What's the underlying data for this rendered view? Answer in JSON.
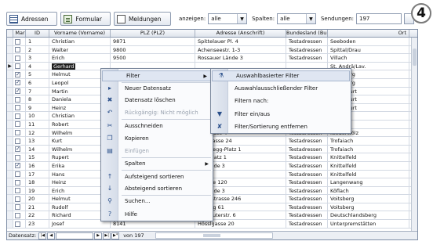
{
  "tabs": [
    {
      "label": "Adressen",
      "icon": "table-icon"
    },
    {
      "label": "Formular",
      "icon": "form-icon"
    },
    {
      "label": "Meldungen",
      "icon": "document-icon"
    }
  ],
  "toolbar": {
    "anzeigen_label": "anzeigen:",
    "anzeigen_value": "alle",
    "spalten_label": "Spalten:",
    "spalten_value": "alle",
    "sendungen_label": "Sendungen:",
    "sendungen_value": "197"
  },
  "badge": "4",
  "grid": {
    "columns": [
      "Mar",
      "ID",
      "Vorname (Vorname)",
      "PLZ (PLZ)",
      "Adresse (Anschrift)",
      "Bundesland (Bun",
      "Ort"
    ],
    "rows": [
      {
        "marked": false,
        "id": "1",
        "name": "Christian",
        "plz": "9871",
        "adresse": "Spittelauer Pl. 4",
        "bundesland": "Testadressen",
        "ort": "Seeboden"
      },
      {
        "marked": false,
        "id": "2",
        "name": "Walter",
        "plz": "9800",
        "adresse": "Achenseestr. 1-3",
        "bundesland": "Testadressen",
        "ort": "Spittal/Drau"
      },
      {
        "marked": false,
        "id": "3",
        "name": "Erich",
        "plz": "9500",
        "adresse": "Rossauer Lände 3",
        "bundesland": "Testadressen",
        "ort": "Villach"
      },
      {
        "marked": false,
        "id": "4",
        "name": "Gerhard",
        "plz": "",
        "adresse": "",
        "bundesland": "",
        "ort": "St. Andrä/Lav.",
        "current": true
      },
      {
        "marked": true,
        "id": "5",
        "name": "Helmut",
        "plz": "",
        "adresse": "",
        "bundesland": "",
        "ort": "Moosburg"
      },
      {
        "marked": true,
        "id": "6",
        "name": "Leopol",
        "plz": "",
        "adresse": "",
        "bundesland": "",
        "ort": "Moosburg"
      },
      {
        "marked": true,
        "id": "7",
        "name": "Martin",
        "plz": "",
        "adresse": "",
        "bundesland": "",
        "ort": "Klagenfurt"
      },
      {
        "marked": false,
        "id": "8",
        "name": "Daniela",
        "plz": "",
        "adresse": "",
        "bundesland": "",
        "ort": "Klagenfurt"
      },
      {
        "marked": false,
        "id": "9",
        "name": "Heinz",
        "plz": "",
        "adresse": "",
        "bundesland": "",
        "ort": "Klagenfurt"
      },
      {
        "marked": false,
        "id": "10",
        "name": "Christian",
        "plz": "",
        "adresse": "",
        "bundesland": "",
        "ort": "Gerding"
      },
      {
        "marked": false,
        "id": "11",
        "name": "Robert",
        "plz": "",
        "adresse": "",
        "bundesland": "",
        "ort": "Liezen"
      },
      {
        "marked": false,
        "id": "12",
        "name": "Wilhelm",
        "plz": "",
        "adresse": "bengasse 4",
        "bundesland": "Testadressen",
        "ort": "Niederwölz"
      },
      {
        "marked": false,
        "id": "13",
        "name": "Kurt",
        "plz": "",
        "adresse": "aulstrasse 24",
        "bundesland": "Testadressen",
        "ort": "Trofaiach"
      },
      {
        "marked": true,
        "id": "14",
        "name": "Wilhelm",
        "plz": "",
        "adresse": "x-Jauregg-Platz 1",
        "bundesland": "Testadressen",
        "ort": "Trofaiach"
      },
      {
        "marked": false,
        "id": "15",
        "name": "Rupert",
        "plz": "",
        "adresse": "enerplatz 1",
        "bundesland": "Testadressen",
        "ort": "Knittelfeld"
      },
      {
        "marked": true,
        "id": "16",
        "name": "Erika",
        "plz": "",
        "adresse": "er Lände 3",
        "bundesland": "Testadressen",
        "ort": "Knittelfeld"
      },
      {
        "marked": false,
        "id": "17",
        "name": "Hans",
        "plz": "",
        "adresse": "tz 13a",
        "bundesland": "Testadressen",
        "ort": "Knittelfeld"
      },
      {
        "marked": false,
        "id": "18",
        "name": "Heinz",
        "plz": "",
        "adresse": "enzeile 120",
        "bundesland": "Testadressen",
        "ort": "Langenwang"
      },
      {
        "marked": false,
        "id": "19",
        "name": "Erich",
        "plz": "",
        "adresse": "er Lände 3",
        "bundesland": "Testadressen",
        "ort": "Köflach"
      },
      {
        "marked": false,
        "id": "20",
        "name": "Helmut",
        "plz": "",
        "adresse": "urgerstrasse 246",
        "bundesland": "Testadressen",
        "ort": "Voitsberg"
      },
      {
        "marked": false,
        "id": "21",
        "name": "Rudolf",
        "plz": "",
        "adresse": "uhlweg 61",
        "bundesland": "Testadressen",
        "ort": "Voitsberg"
      },
      {
        "marked": false,
        "id": "22",
        "name": "Richard",
        "plz": "8530",
        "adresse": "Computerstr. 6",
        "bundesland": "Testadressen",
        "ort": "Deutschlandsberg"
      },
      {
        "marked": false,
        "id": "23",
        "name": "Josef",
        "plz": "8141",
        "adresse": "Hösslgasse 20",
        "bundesland": "Testadressen",
        "ort": "Unterpremstätten"
      }
    ]
  },
  "nav": {
    "label": "Datensatz:",
    "of_label": "von 197"
  },
  "context_menu": {
    "items": [
      {
        "label": "Filter",
        "icon": "filter-icon",
        "highlight": true,
        "submenu": true
      },
      {
        "label": "Neuer Datensatz",
        "icon": "new-record-icon"
      },
      {
        "label": "Datensatz löschen",
        "icon": "delete-icon"
      },
      {
        "label": "Rückgängig: Nicht möglich",
        "icon": "undo-icon",
        "disabled": true
      },
      {
        "label": "Ausschneiden",
        "icon": "cut-icon"
      },
      {
        "label": "Kopieren",
        "icon": "copy-icon"
      },
      {
        "label": "Einfügen",
        "icon": "paste-icon",
        "disabled": true
      },
      {
        "label": "Spalten",
        "icon": "",
        "submenu": true
      },
      {
        "label": "Aufsteigend sortieren",
        "icon": "sort-asc-icon"
      },
      {
        "label": "Absteigend sortieren",
        "icon": "sort-desc-icon"
      },
      {
        "label": "Suchen...",
        "icon": "search-icon"
      },
      {
        "label": "Hilfe",
        "icon": "help-icon"
      }
    ]
  },
  "filter_submenu": {
    "items": [
      {
        "label": "Auswahlbasierter Filter",
        "icon": "filter-selection-icon",
        "highlight": true
      },
      {
        "label": "Auswahlausschließender Filter",
        "icon": ""
      },
      {
        "label": "Filtern nach:",
        "icon": ""
      },
      {
        "label": "Filter ein/aus",
        "icon": "filter-toggle-icon"
      },
      {
        "label": "Filter/Sortierung entfernen",
        "icon": "filter-remove-icon"
      }
    ]
  }
}
